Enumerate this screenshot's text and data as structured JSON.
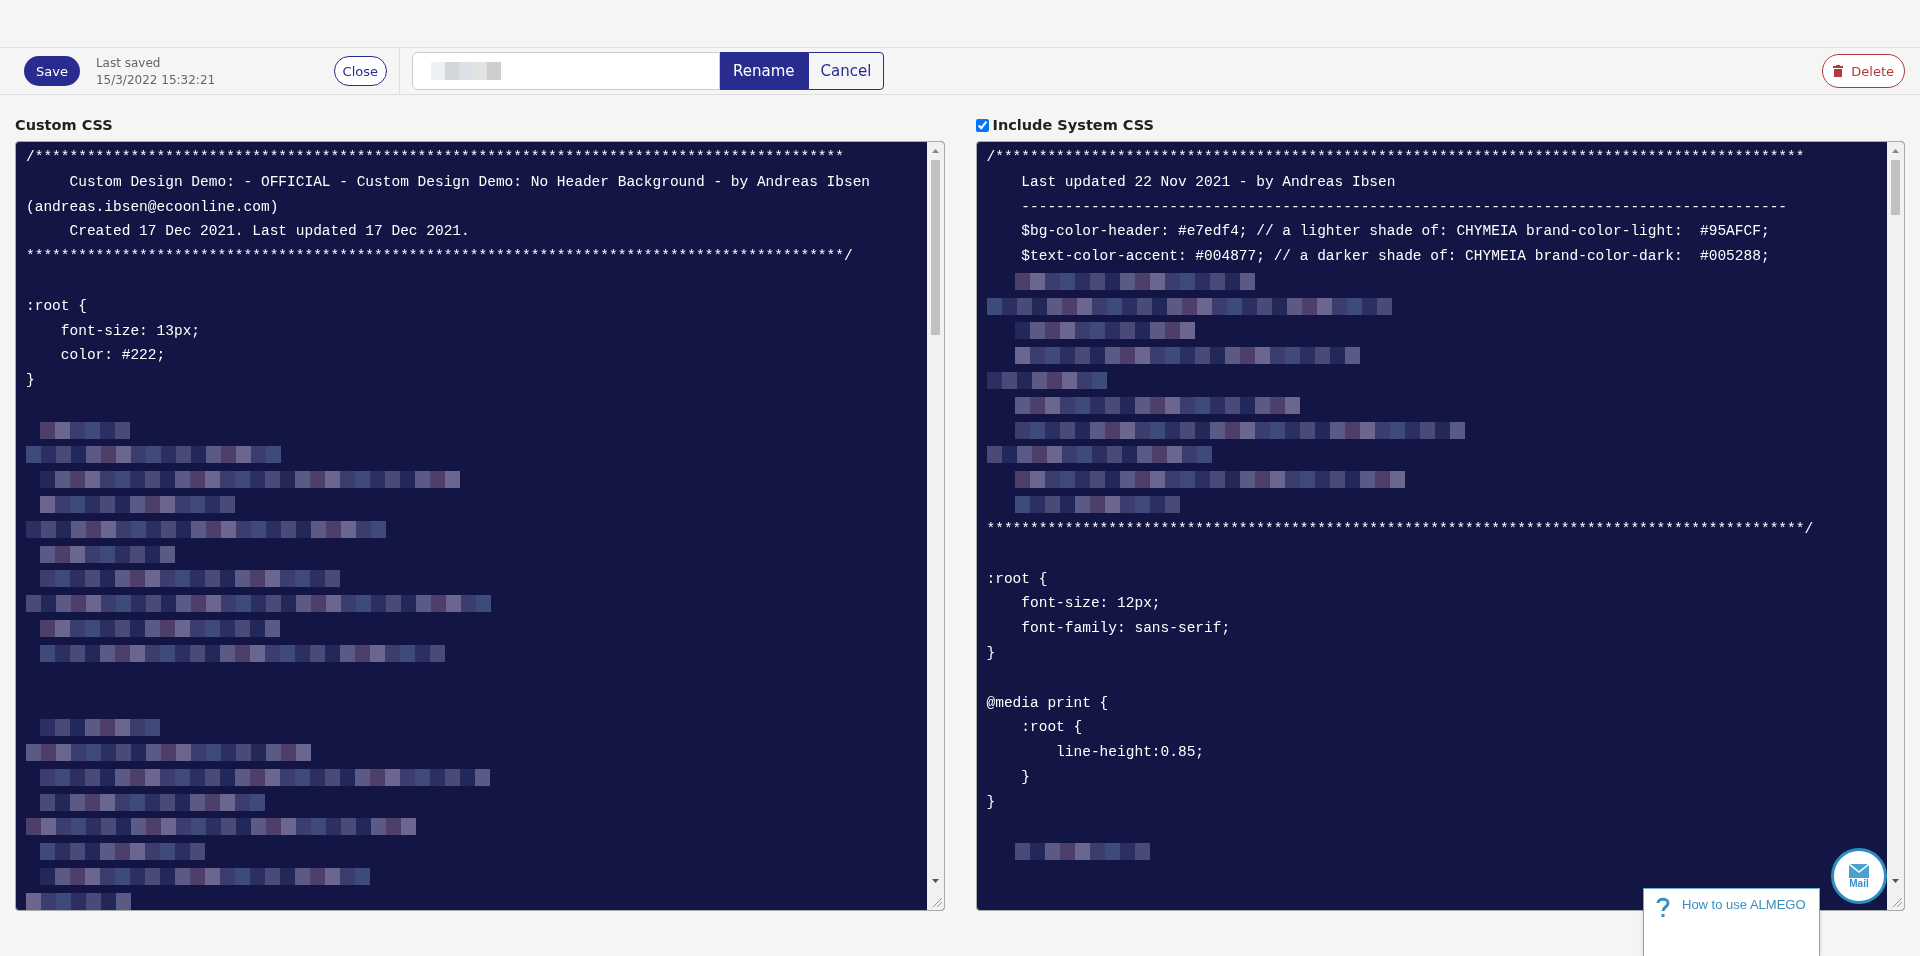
{
  "toolbar": {
    "save": "Save",
    "last_saved_label": "Last saved",
    "last_saved_time": "15/3/2022 15:32:21",
    "close": "Close",
    "rename": "Rename",
    "cancel": "Cancel",
    "delete": "Delete"
  },
  "editors": [
    {
      "label": "Custom CSS",
      "lines": [
        {
          "kind": "code",
          "text": "/*********************************************************************************************"
        },
        {
          "kind": "code",
          "text": "     Custom Design Demo: - OFFICIAL - Custom Design Demo: No Header Background - by Andreas Ibsen"
        },
        {
          "kind": "code",
          "text": "(andreas.ibsen@ecoonline.com)"
        },
        {
          "kind": "code",
          "text": "     Created 17 Dec 2021. Last updated 17 Dec 2021."
        },
        {
          "kind": "code",
          "text": "**********************************************************************************************/"
        },
        {
          "kind": "blank"
        },
        {
          "kind": "code",
          "text": ":root {"
        },
        {
          "kind": "code",
          "text": "    font-size: 13px;"
        },
        {
          "kind": "code",
          "text": "    color: #222;"
        },
        {
          "kind": "code",
          "text": "}"
        },
        {
          "kind": "blank"
        },
        {
          "kind": "redacted"
        },
        {
          "kind": "redacted"
        },
        {
          "kind": "redacted"
        },
        {
          "kind": "redacted"
        },
        {
          "kind": "redacted"
        },
        {
          "kind": "redacted"
        },
        {
          "kind": "redacted"
        },
        {
          "kind": "redacted"
        },
        {
          "kind": "redacted"
        },
        {
          "kind": "redacted"
        },
        {
          "kind": "blank"
        },
        {
          "kind": "blank"
        },
        {
          "kind": "redacted"
        },
        {
          "kind": "redacted"
        },
        {
          "kind": "redacted"
        },
        {
          "kind": "redacted"
        },
        {
          "kind": "redacted"
        },
        {
          "kind": "redacted"
        },
        {
          "kind": "redacted"
        },
        {
          "kind": "redacted"
        }
      ]
    },
    {
      "label": "Include System CSS",
      "checkbox": {
        "checked": true
      },
      "lines": [
        {
          "kind": "code",
          "text": "/*********************************************************************************************"
        },
        {
          "kind": "code",
          "text": "    Last updated 22 Nov 2021 - by Andreas Ibsen"
        },
        {
          "kind": "code",
          "text": "    ----------------------------------------------------------------------------------------"
        },
        {
          "kind": "code",
          "text": "    $bg-color-header: #e7edf4; // a lighter shade of: CHYMEIA brand-color-light:  #95AFCF;"
        },
        {
          "kind": "code",
          "text": "    $text-color-accent: #004877; // a darker shade of: CHYMEIA brand-color-dark:  #005288;"
        },
        {
          "kind": "redacted"
        },
        {
          "kind": "redacted"
        },
        {
          "kind": "redacted"
        },
        {
          "kind": "redacted"
        },
        {
          "kind": "redacted"
        },
        {
          "kind": "redacted"
        },
        {
          "kind": "redacted"
        },
        {
          "kind": "redacted"
        },
        {
          "kind": "redacted"
        },
        {
          "kind": "redacted"
        },
        {
          "kind": "code",
          "text": "**********************************************************************************************/"
        },
        {
          "kind": "blank"
        },
        {
          "kind": "code",
          "text": ":root {"
        },
        {
          "kind": "code",
          "text": "    font-size: 12px;"
        },
        {
          "kind": "code",
          "text": "    font-family: sans-serif;"
        },
        {
          "kind": "code",
          "text": "}"
        },
        {
          "kind": "blank"
        },
        {
          "kind": "code",
          "text": "@media print {"
        },
        {
          "kind": "code",
          "text": "    :root {"
        },
        {
          "kind": "code",
          "text": "        line-height:0.85;"
        },
        {
          "kind": "code",
          "text": "    }"
        },
        {
          "kind": "code",
          "text": "}"
        },
        {
          "kind": "blank"
        },
        {
          "kind": "redacted"
        }
      ]
    }
  ],
  "mail_button": {
    "label": "Mail"
  },
  "help_tab": {
    "label": "How to use ALMEGO"
  }
}
